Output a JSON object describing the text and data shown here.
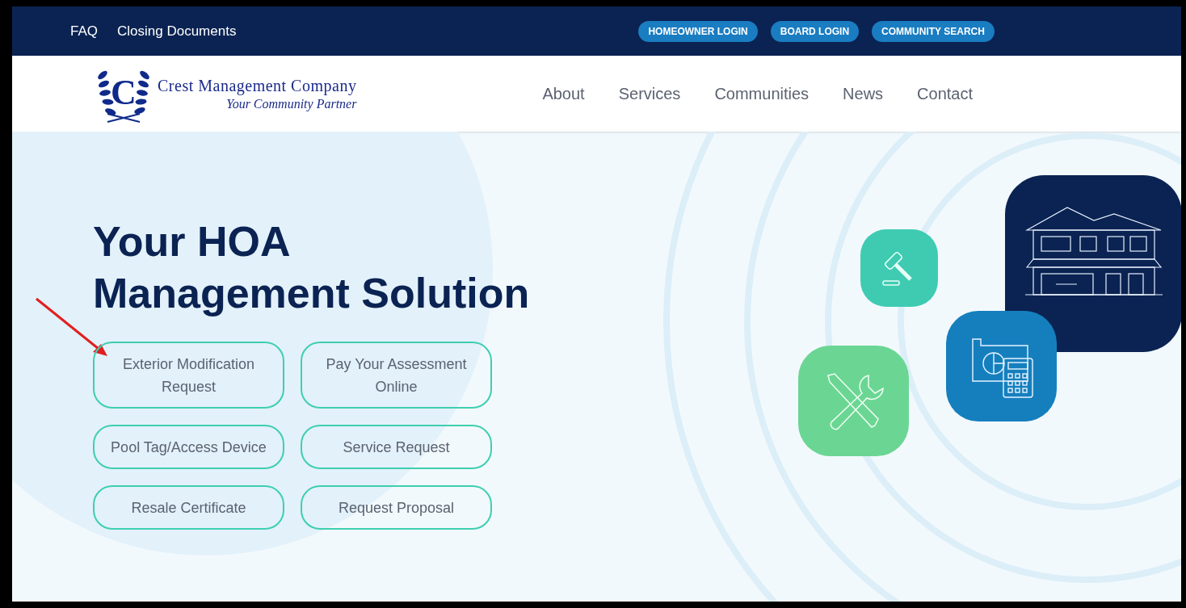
{
  "top_bar": {
    "links": [
      "FAQ",
      "Closing Documents"
    ],
    "buttons": [
      "HOMEOWNER LOGIN",
      "BOARD LOGIN",
      "COMMUNITY SEARCH"
    ]
  },
  "header": {
    "logo": {
      "letter": "C",
      "name": "Crest Management Company",
      "tagline": "Your Community Partner"
    },
    "nav": [
      "About",
      "Services",
      "Communities",
      "News",
      "Contact"
    ]
  },
  "hero": {
    "heading": [
      "Your HOA",
      "Management Solution"
    ],
    "actions": [
      {
        "label": "Exterior Modification Request"
      },
      {
        "label": "Pay Your Assessment Online"
      },
      {
        "label": "Pool Tag/Access Device"
      },
      {
        "label": "Service Request"
      },
      {
        "label": "Resale Certificate"
      },
      {
        "label": "Request Proposal"
      }
    ]
  }
}
